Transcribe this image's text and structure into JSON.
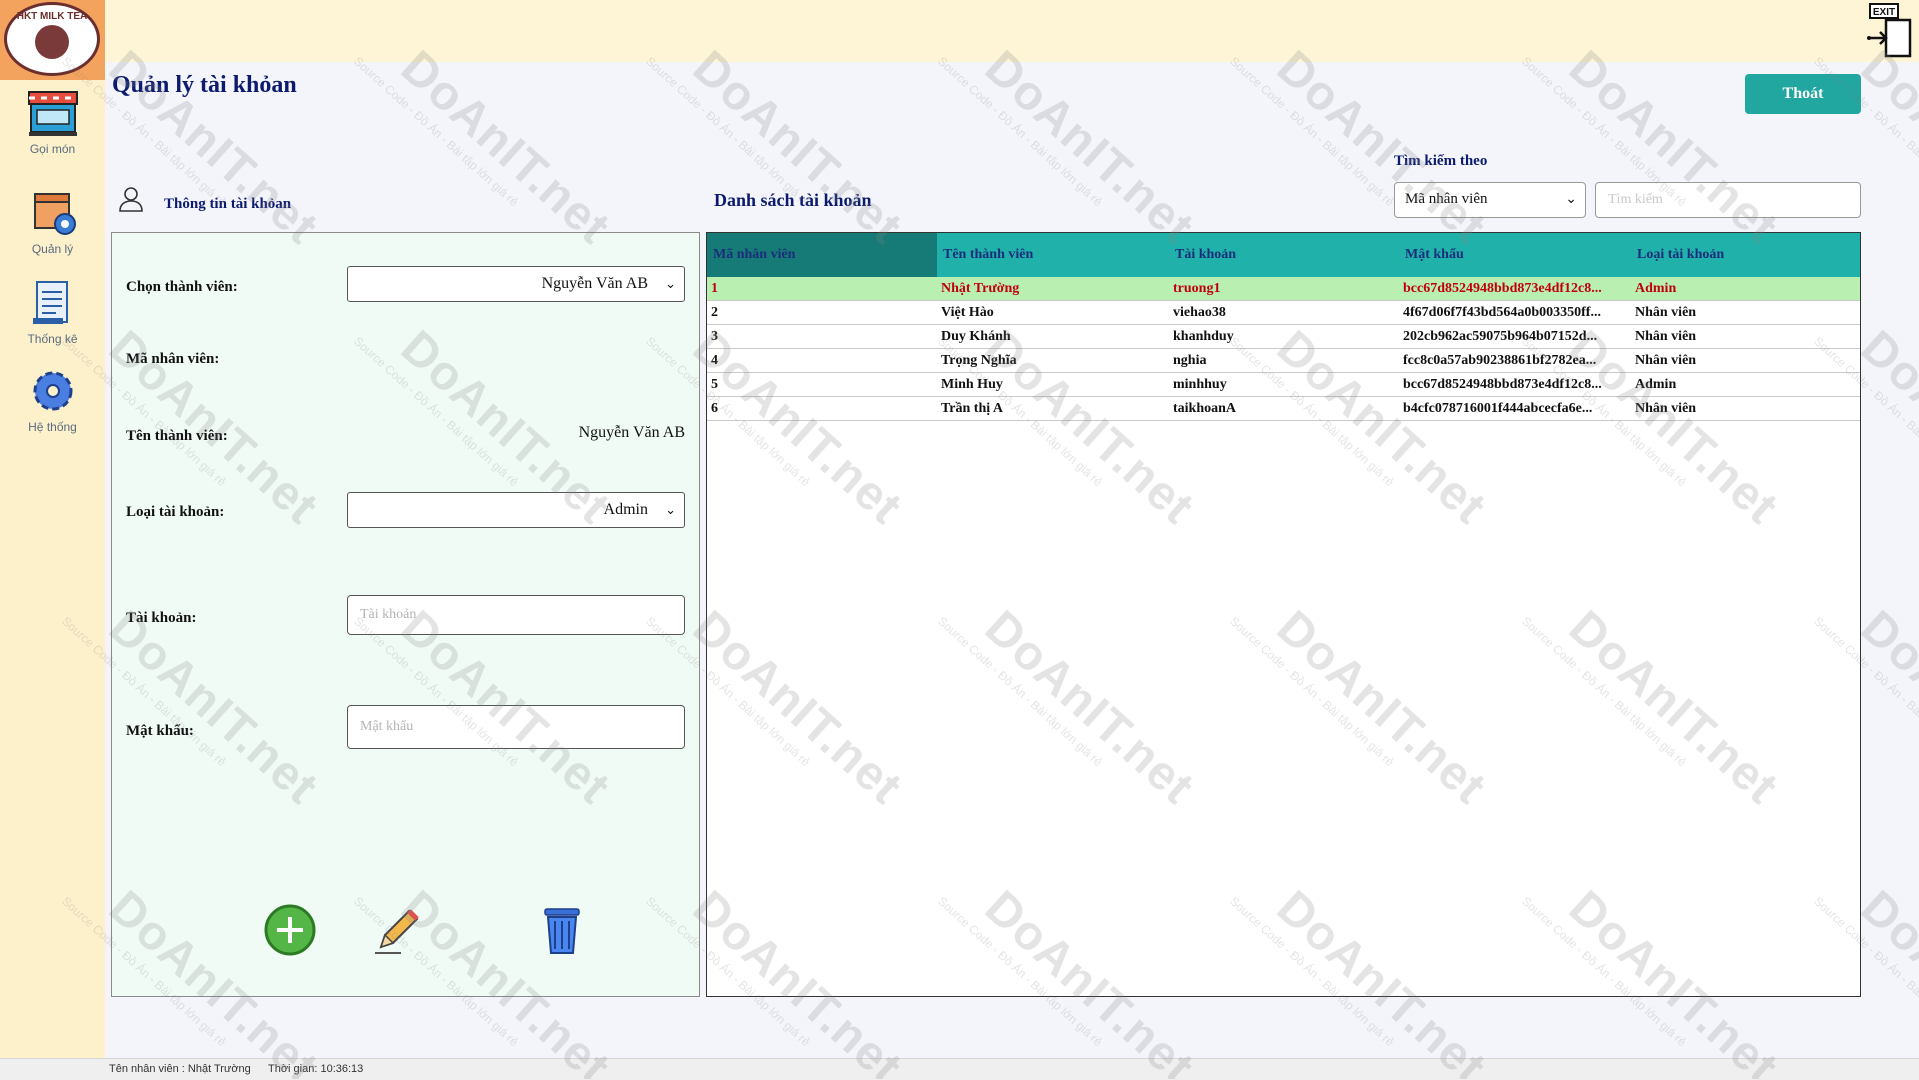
{
  "sidebar": {
    "logo_text": "HKT MILK TEA",
    "items": [
      {
        "label": "Gọi món",
        "icon": "store-icon"
      },
      {
        "label": "Quản lý",
        "icon": "manage-box-icon"
      },
      {
        "label": "Thống kê",
        "icon": "report-icon"
      },
      {
        "label": "Hệ thống",
        "icon": "gear-icon"
      }
    ]
  },
  "header": {
    "title": "Quản lý tài khỏan",
    "exit_button": "Thoát",
    "exit_icon": "exit-door-icon"
  },
  "search": {
    "label": "Tìm kiếm theo",
    "select_value": "Mã nhân viên",
    "placeholder": "Tìm kiếm"
  },
  "info_panel": {
    "title": "Thông tin tài khỏan",
    "choose_member_label": "Chọn thành viên:",
    "choose_member_value": "Nguyễn Văn AB",
    "employee_id_label": "Mã nhân viên:",
    "member_name_label": "Tên thành viên:",
    "member_name_value": "Nguyễn Văn AB",
    "account_type_label": "Loại tài khoản:",
    "account_type_value": "Admin",
    "account_label": "Tài khoản:",
    "account_placeholder": "Tài khoản",
    "password_label": "Mật khẩu:",
    "password_placeholder": "Mật khẩu",
    "actions": [
      "add-icon",
      "edit-pencil-icon",
      "trash-icon"
    ]
  },
  "list_panel": {
    "title": "Danh sách tài khoản",
    "columns": [
      "Mã nhân viên",
      "Tên thành viên",
      "Tài khoản",
      "Mật khẩu",
      "Loại tài khoản"
    ],
    "rows": [
      [
        "1",
        "Nhật Trường",
        "truong1",
        "bcc67d8524948bbd873e4df12c8...",
        "Admin"
      ],
      [
        "2",
        "Việt Hào",
        "viehao38",
        "4f67d06f7f43bd564a0b003350ff...",
        "Nhân viên"
      ],
      [
        "3",
        "Duy Khánh",
        "khanhduy",
        "202cb962ac59075b964b07152d...",
        "Nhân viên"
      ],
      [
        "4",
        "Trọng Nghĩa",
        "nghia",
        "fcc8c0a57ab90238861bf2782ea...",
        "Nhân viên"
      ],
      [
        "5",
        "Minh Huy",
        "minhhuy",
        "bcc67d8524948bbd873e4df12c8...",
        "Admin"
      ],
      [
        "6",
        "Trần thị A",
        "taikhoanA",
        "b4cfc078716001f444abcecfa6e...",
        "Nhân viên"
      ]
    ],
    "selected_row": 0
  },
  "statusbar": {
    "employee": "Tên nhân viên : Nhật Trường",
    "time": "Thời gian: 10:36:13"
  },
  "colors": {
    "accent": "#20b2aa",
    "title": "#0d1b6e",
    "sidebar_bg": "#fdf1cc",
    "selected_row_bg": "#b9f0b2",
    "selected_row_text": "#c0000f"
  },
  "watermark": {
    "brand": "DoAnIT.net",
    "tagline": "Source Code - Đồ Án - Bài tập lớn giá rẻ"
  }
}
